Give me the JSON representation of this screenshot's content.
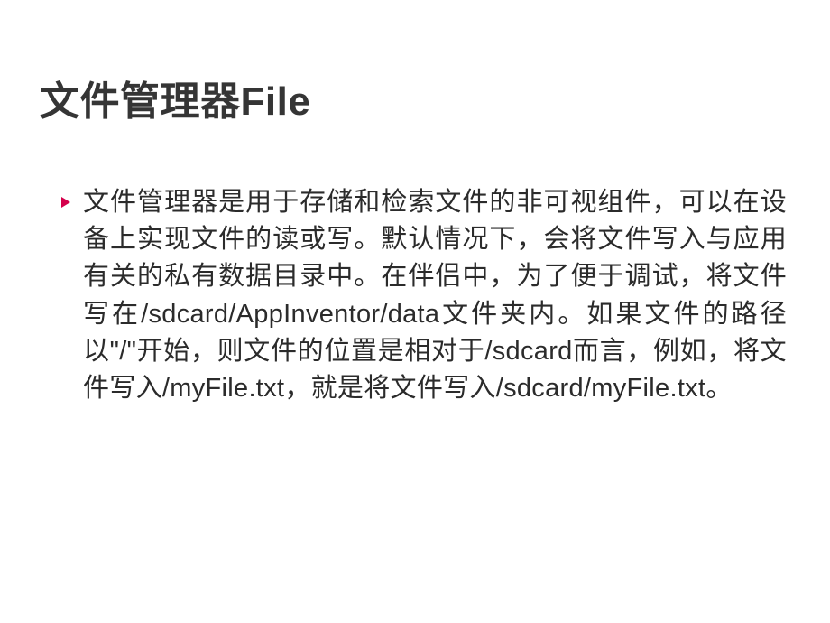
{
  "title": "文件管理器File",
  "bullet_glyph": "▶",
  "body_text": "文件管理器是用于存储和检索文件的非可视组件，可以在设备上实现文件的读或写。默认情况下，会将文件写入与应用有关的私有数据目录中。在伴侣中，为了便于调试，将文件写在/sdcard/AppInventor/data文件夹内。如果文件的路径以\"/\"开始，则文件的位置是相对于/sdcard而言，例如，将文件写入/myFile.txt，就是将文件写入/sdcard/myFile.txt。"
}
